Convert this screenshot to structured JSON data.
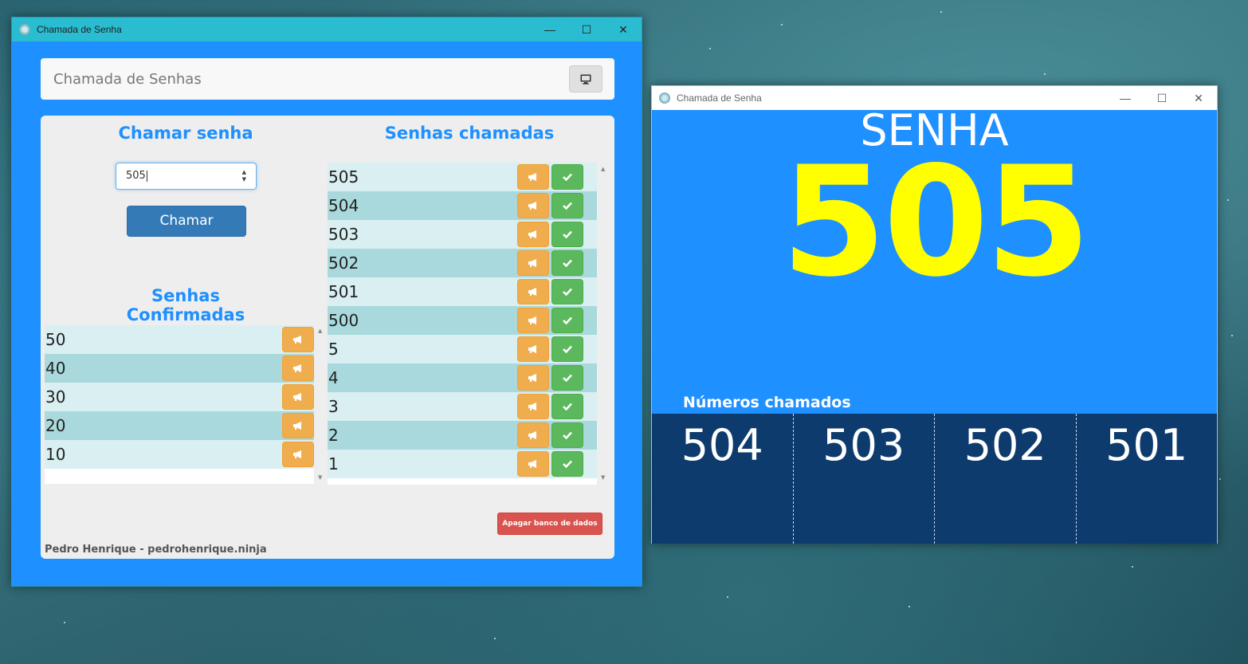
{
  "window_main": {
    "title": "Chamada de Senha",
    "navbar_brand": "Chamada de Senhas",
    "chamar": {
      "heading": "Chamar senha",
      "input_value": "505",
      "button_label": "Chamar"
    },
    "confirmadas": {
      "heading": "Senhas Confirmadas",
      "items": [
        "50",
        "40",
        "30",
        "20",
        "10"
      ]
    },
    "chamadas": {
      "heading": "Senhas chamadas",
      "items": [
        "505",
        "504",
        "503",
        "502",
        "501",
        "500",
        "5",
        "4",
        "3",
        "2",
        "1"
      ]
    },
    "apagar_label": "Apagar banco de dados",
    "credit": "Pedro Henrique - pedrohenrique.ninja"
  },
  "window_display": {
    "title": "Chamada de Senha",
    "senha_label": "SENHA",
    "current_number": "505",
    "chamados_label": "Números chamados",
    "chamados": [
      "504",
      "503",
      "502",
      "501"
    ]
  },
  "colors": {
    "primary": "#1e90ff",
    "highlight": "#ffff00",
    "dark_panel": "#0d3b6e",
    "warning": "#f0ad4e",
    "success": "#5cb85c",
    "danger": "#d9534f"
  }
}
